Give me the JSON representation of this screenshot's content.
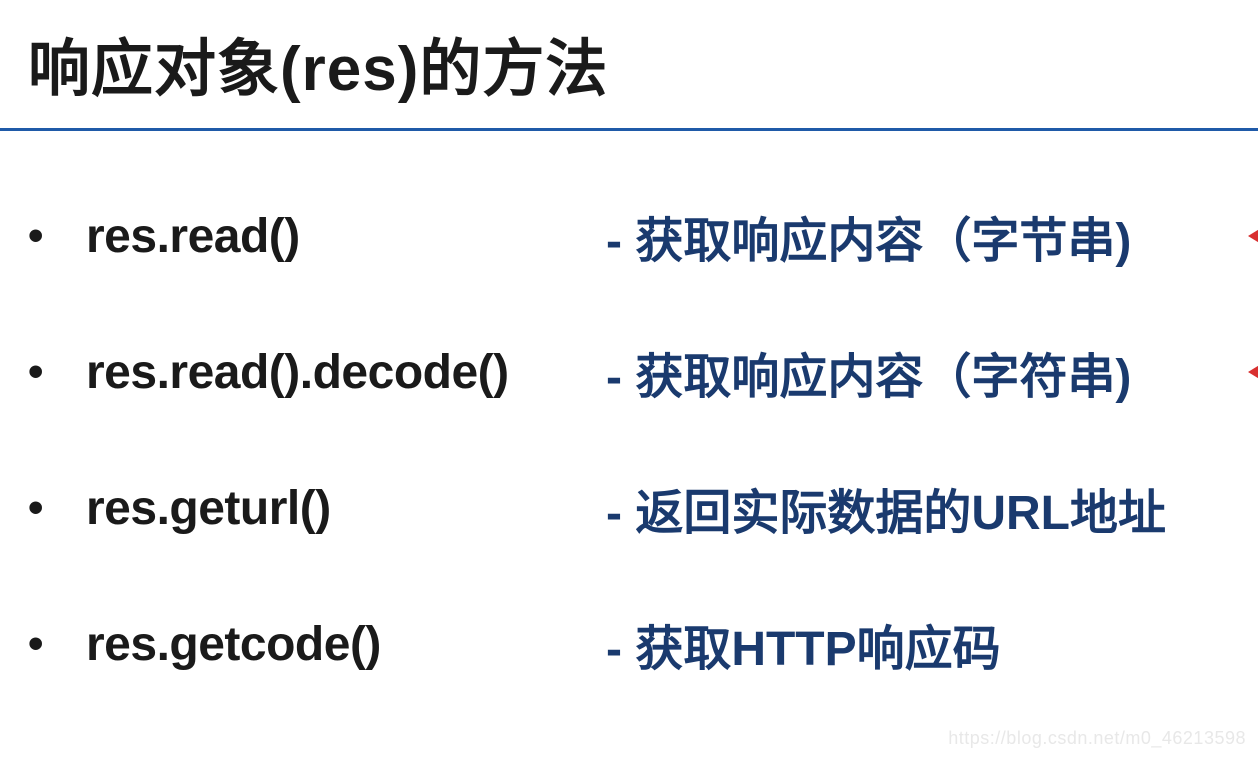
{
  "title": "响应对象(res)的方法",
  "items": [
    {
      "method": "res.read()",
      "desc": "- 获取响应内容（字节串)",
      "hasArrow": true
    },
    {
      "method": "res.read().decode()",
      "desc": "- 获取响应内容（字符串)",
      "hasArrow": true
    },
    {
      "method": "res.geturl()",
      "desc": "- 返回实际数据的URL地址",
      "hasArrow": false
    },
    {
      "method": "res.getcode()",
      "desc": "- 获取HTTP响应码",
      "hasArrow": false
    }
  ],
  "watermark": "https://blog.csdn.net/m0_46213598"
}
